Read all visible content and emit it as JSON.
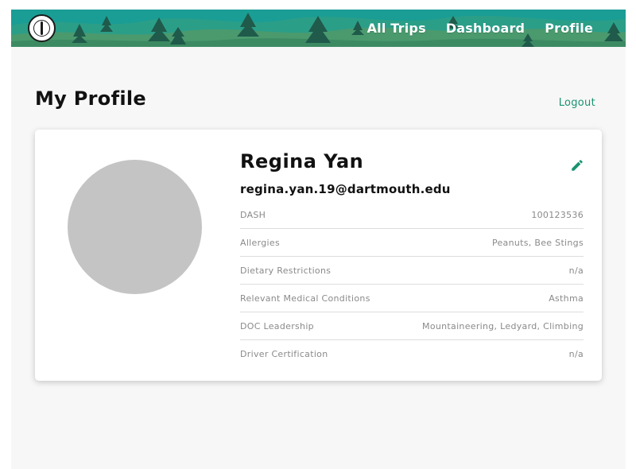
{
  "nav": {
    "links": [
      "All Trips",
      "Dashboard",
      "Profile"
    ],
    "logo_icon": "doc-seal-logo",
    "bar_color": "#1a9d95"
  },
  "page": {
    "title": "My Profile",
    "logout_label": "Logout",
    "accent_color": "#1a9270"
  },
  "profile": {
    "name": "Regina Yan",
    "email": "regina.yan.19@dartmouth.edu",
    "edit_icon": "pencil-icon",
    "fields": [
      {
        "label": "DASH",
        "value": "100123536"
      },
      {
        "label": "Allergies",
        "value": "Peanuts, Bee Stings"
      },
      {
        "label": "Dietary Restrictions",
        "value": "n/a"
      },
      {
        "label": "Relevant Medical Conditions",
        "value": "Asthma"
      },
      {
        "label": "DOC Leadership",
        "value": "Mountaineering, Ledyard, Climbing"
      },
      {
        "label": "Driver Certification",
        "value": "n/a"
      }
    ]
  }
}
